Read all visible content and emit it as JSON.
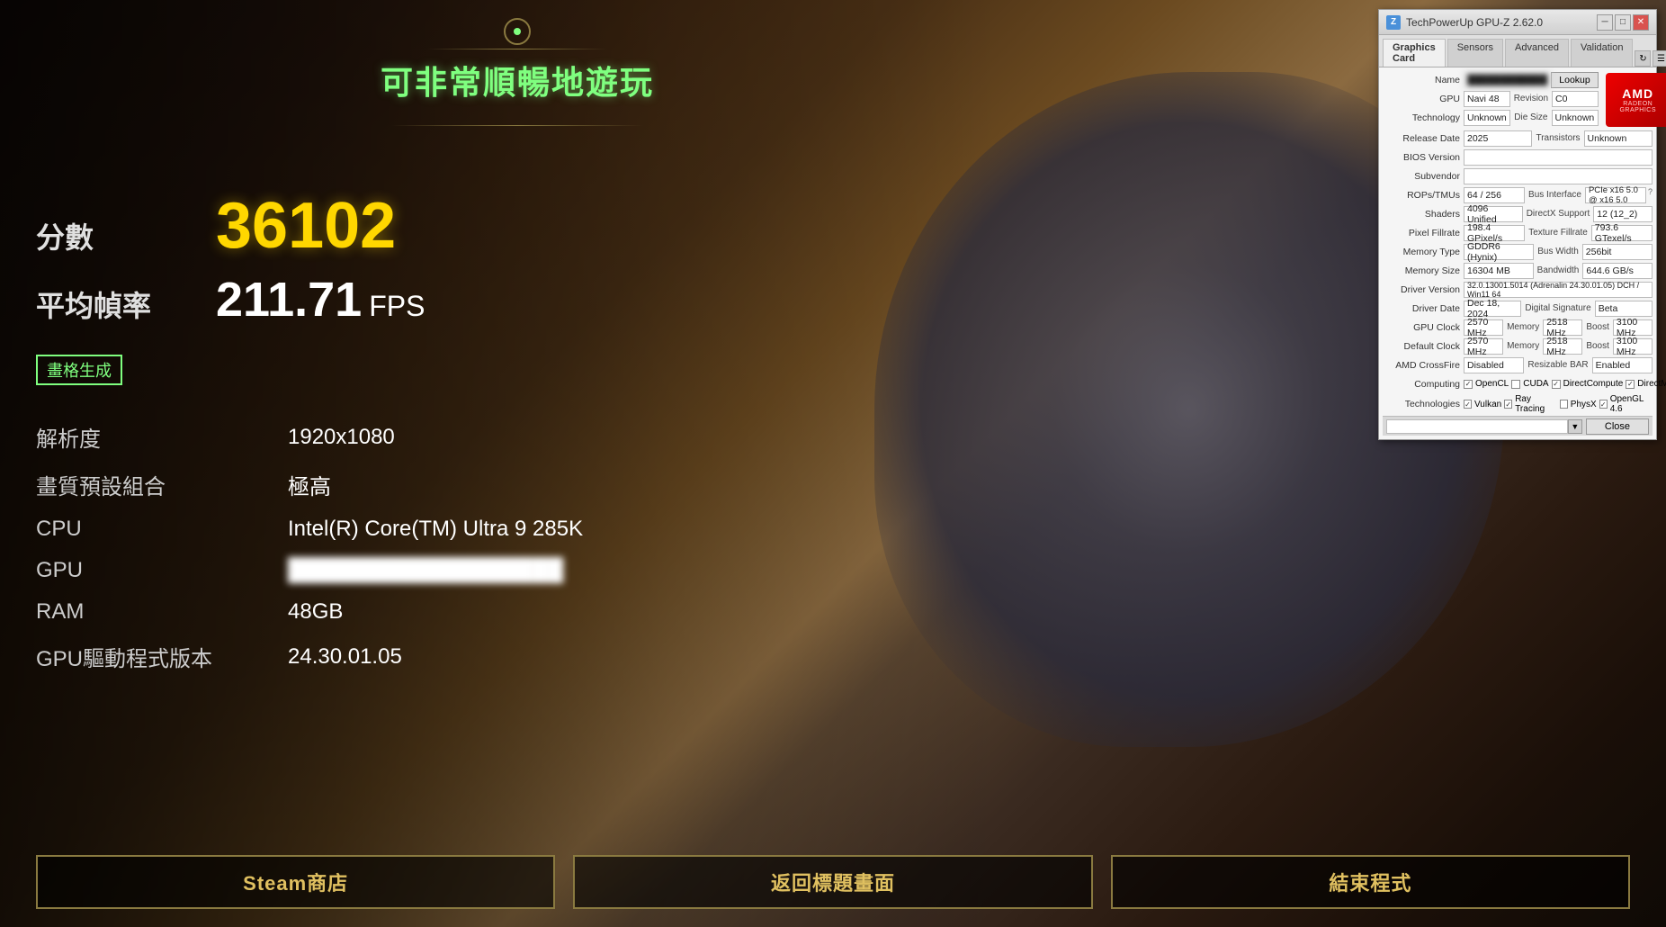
{
  "game": {
    "background_color": "#1a0f0a",
    "performance_label": "可非常順暢地遊玩",
    "score_label": "分數",
    "score_value": "36102",
    "fps_label": "平均幀率",
    "fps_value": "211.71",
    "fps_unit": "FPS",
    "frame_gen_label": "畫格生成"
  },
  "system_info": {
    "resolution_label": "解析度",
    "resolution_value": "1920x1080",
    "quality_label": "畫質預設組合",
    "quality_value": "極高",
    "cpu_label": "CPU",
    "cpu_value": "Intel(R) Core(TM) Ultra 9 285K",
    "gpu_label": "GPU",
    "gpu_value": "AMD Radeon RX 7900 XT",
    "ram_label": "RAM",
    "ram_value": "48GB",
    "driver_label": "GPU驅動程式版本",
    "driver_value": "24.30.01.05"
  },
  "buttons": {
    "steam_label": "Steam商店",
    "home_label": "返回標題畫面",
    "exit_label": "結束程式"
  },
  "gpuz": {
    "title": "TechPowerUp GPU-Z 2.62.0",
    "tabs": [
      "Graphics Card",
      "Sensors",
      "Advanced",
      "Validation"
    ],
    "name_label": "Name",
    "name_value": "",
    "lookup_btn": "Lookup",
    "gpu_label": "GPU",
    "gpu_value": "Navi 48",
    "revision_label": "Revision",
    "revision_value": "C0",
    "technology_label": "Technology",
    "technology_value": "Unknown",
    "die_size_label": "Die Size",
    "die_size_value": "Unknown",
    "release_date_label": "Release Date",
    "release_date_value": "2025",
    "transistors_label": "Transistors",
    "transistors_value": "Unknown",
    "bios_version_label": "BIOS Version",
    "bios_version_value": "",
    "subvendor_label": "Subvendor",
    "subvendor_value": "",
    "rops_label": "ROPs/TMUs",
    "rops_value": "64 / 256",
    "bus_interface_label": "Bus Interface",
    "bus_interface_value": "PCIe x16 5.0 @ x16 5.0",
    "bus_interface_question": "?",
    "shaders_label": "Shaders",
    "shaders_value": "4096 Unified",
    "directx_label": "DirectX Support",
    "directx_value": "12 (12_2)",
    "pixel_fillrate_label": "Pixel Fillrate",
    "pixel_fillrate_value": "198.4 GPixel/s",
    "texture_fillrate_label": "Texture Fillrate",
    "texture_fillrate_value": "793.6 GTexel/s",
    "memory_type_label": "Memory Type",
    "memory_type_value": "GDDR6 (Hynix)",
    "bus_width_label": "Bus Width",
    "bus_width_value": "256bit",
    "memory_size_label": "Memory Size",
    "memory_size_value": "16304 MB",
    "bandwidth_label": "Bandwidth",
    "bandwidth_value": "644.6 GB/s",
    "driver_version_label": "Driver Version",
    "driver_version_value": "32.0.13001.5014 (Adrenalin 24.30.01.05) DCH / Win11 64",
    "driver_date_label": "Driver Date",
    "driver_date_value": "Dec 18, 2024",
    "digital_sig_label": "Digital Signature",
    "digital_sig_value": "Beta",
    "gpu_clock_label": "GPU Clock",
    "gpu_clock_value": "2570 MHz",
    "memory_clock_label": "Memory",
    "memory_clock_value": "2518 MHz",
    "boost_label": "Boost",
    "boost_value": "3100 MHz",
    "default_clock_label": "Default Clock",
    "default_clock_value": "2570 MHz",
    "default_mem_label": "Memory",
    "default_mem_value": "2518 MHz",
    "default_boost_label": "Boost",
    "default_boost_value": "3100 MHz",
    "crossfire_label": "AMD CrossFire",
    "crossfire_value": "Disabled",
    "resizable_bar_label": "Resizable BAR",
    "resizable_bar_value": "Enabled",
    "computing_label": "Computing",
    "opencl_label": "OpenCL",
    "cuda_label": "CUDA",
    "direct_compute_label": "DirectCompute",
    "directml_label": "DirectML",
    "technologies_label": "Technologies",
    "vulkan_label": "Vulkan",
    "ray_tracing_label": "Ray Tracing",
    "physx_label": "PhysX",
    "opengl_label": "OpenGL 4.6",
    "close_btn": "Close",
    "amd_logo": "AMD",
    "amd_sub": "RADEON\nGRAPHICS"
  }
}
